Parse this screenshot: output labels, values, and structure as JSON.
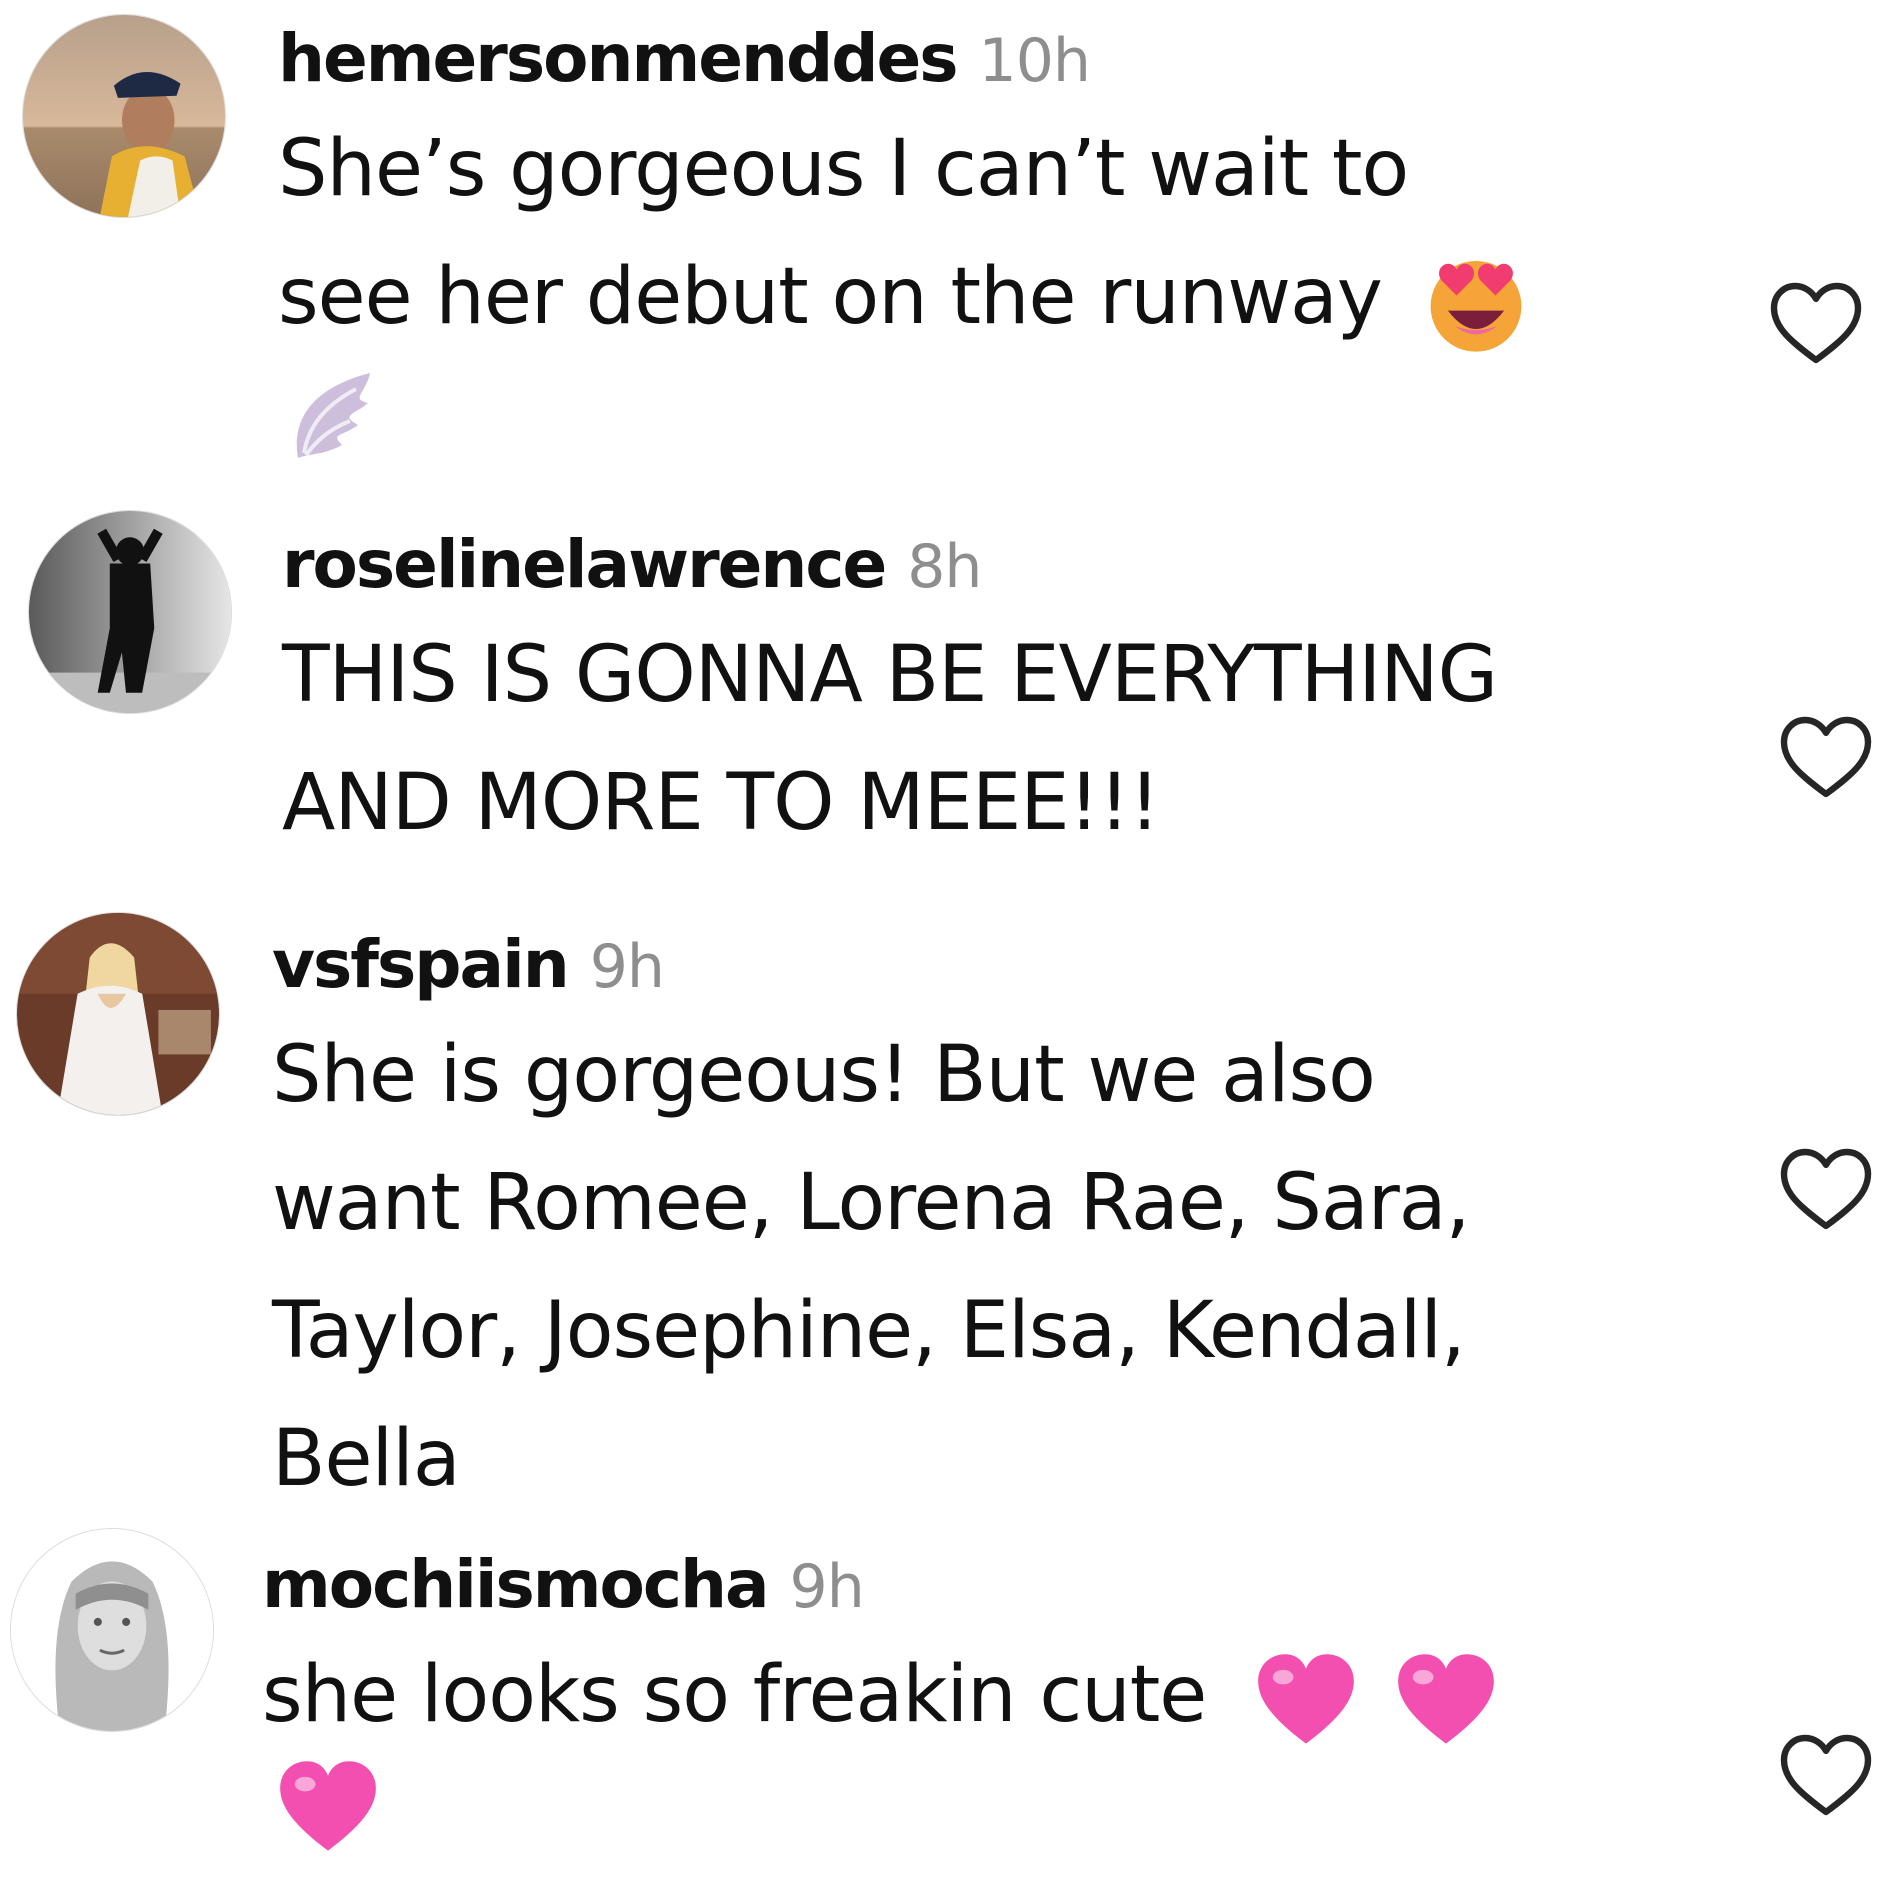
{
  "comments": [
    {
      "username": "hemersonmenddes",
      "time": "10h",
      "lines": [
        "She’s gorgeous I can’t wait to",
        "see her debut on the runway"
      ],
      "emojis": [
        "heart-eyes-emoji",
        "wing-emoji"
      ],
      "avatar": "avatar-hemersonmenddes"
    },
    {
      "username": "roselinelawrence",
      "time": "8h",
      "lines": [
        "THIS IS GONNA BE EVERYTHING",
        "AND MORE TO MEEE!!!"
      ],
      "avatar": "avatar-roselinelawrence"
    },
    {
      "username": "vsfspain",
      "time": "9h",
      "lines": [
        "She is gorgeous! But we also",
        "want Romee, Lorena Rae, Sara,",
        "Taylor, Josephine, Elsa, Kendall,",
        "Bella"
      ],
      "avatar": "avatar-vsfspain"
    },
    {
      "username": "mochiismocha",
      "time": "9h",
      "lines": [
        "she looks so freakin cute"
      ],
      "emojis": [
        "pink-heart-emoji",
        "pink-heart-emoji",
        "pink-heart-emoji"
      ],
      "avatar": "avatar-mochiismocha"
    }
  ],
  "colors": {
    "text": "#111111",
    "timestamp": "#8e8e8e",
    "like_outline": "#262626",
    "pink_heart": "#f24fb0"
  },
  "icons": {
    "like": "heart-outline-icon"
  }
}
